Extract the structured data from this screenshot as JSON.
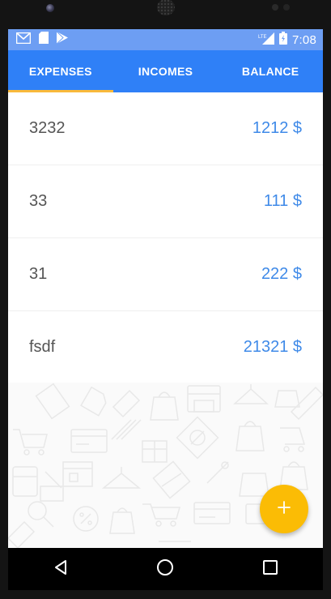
{
  "status_bar": {
    "time": "7:08",
    "network_label": "LTE",
    "left_icons": [
      "gmail-icon",
      "sd-card-icon",
      "play-store-icon"
    ],
    "right_icons": [
      "lte-signal-icon",
      "battery-charging-icon"
    ]
  },
  "tabs": [
    {
      "label": "EXPENSES",
      "active": true
    },
    {
      "label": "INCOMES",
      "active": false
    },
    {
      "label": "BALANCE",
      "active": false
    }
  ],
  "entries": [
    {
      "name": "3232",
      "amount": "1212 $"
    },
    {
      "name": "33",
      "amount": "111 $"
    },
    {
      "name": "31",
      "amount": "222 $"
    },
    {
      "name": "fsdf",
      "amount": "21321 $"
    }
  ],
  "fab": {
    "icon": "plus-icon"
  },
  "nav": {
    "icons": [
      "back-icon",
      "home-icon",
      "recents-icon"
    ]
  },
  "colors": {
    "status_bar": "#6d9ef3",
    "tab_bar": "#2f80f7",
    "tab_indicator": "#f9b93b",
    "amount_text": "#3f8ae8",
    "fab": "#fbbc05"
  }
}
